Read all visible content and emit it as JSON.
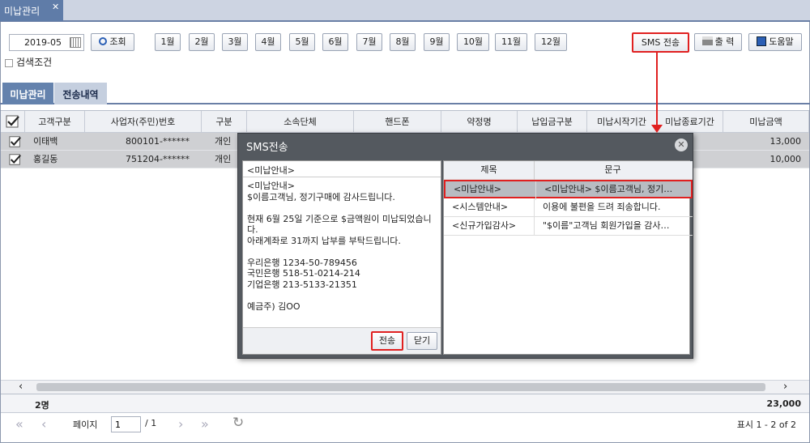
{
  "window": {
    "tab_label": "미납관리",
    "close_glyph": "✕"
  },
  "toolbar": {
    "date_value": "2019-05",
    "search_label": "조회",
    "months": [
      "1월",
      "2월",
      "3월",
      "4월",
      "5월",
      "6월",
      "7월",
      "8월",
      "9월",
      "10월",
      "11월",
      "12월"
    ],
    "sms_label": "SMS 전송",
    "print_label": "출 력",
    "help_label": "도움말"
  },
  "search_condition": {
    "label": "검색조건"
  },
  "subtabs": {
    "tab1": "미납관리",
    "tab2": "전송내역"
  },
  "grid": {
    "headers": [
      "고객구분",
      "사업자(주민)번호",
      "구분",
      "소속단체",
      "핸드폰",
      "약정명",
      "납입금구분",
      "미납시작기간",
      "미납종료기간",
      "미납금액"
    ],
    "rows": [
      {
        "name": "이태백",
        "id": "800101-******",
        "type": "개인",
        "amount": "13,000"
      },
      {
        "name": "홍길동",
        "id": "751204-******",
        "type": "개인",
        "amount": "10,000"
      }
    ]
  },
  "footer": {
    "count": "2명",
    "total": "23,000"
  },
  "pager": {
    "page_label": "페이지",
    "page_value": "1",
    "page_total": "/ 1",
    "display_info": "표시 1 - 2 of 2"
  },
  "modal": {
    "title": "SMS전송",
    "message_title": "<미납안내>",
    "message_lines": [
      "<미납안내>",
      "$이름고객님, 정기구매에 감사드립니다.",
      "",
      "현재 6월 25일 기준으로 $금액원이 미납되었습니다.",
      "아래계좌로 31까지 납부를 부탁드립니다.",
      "",
      "우리은행 1234-50-789456",
      "국민은행 518-51-0214-214",
      "기업은행 213-5133-21351",
      "",
      "예금주) 김OO"
    ],
    "send_label": "전송",
    "close_label": "닫기",
    "list_headers": [
      "제목",
      "문구"
    ],
    "list_rows": [
      {
        "title": "<미납안내>",
        "text": "<미납안내> $이름고객님, 정기…"
      },
      {
        "title": "<시스템안내>",
        "text": "이용에 불편을 드려 죄송합니다."
      },
      {
        "title": "<신규가입감사>",
        "text": "\"$이름\"고객님 회원가입을 감사…"
      }
    ]
  }
}
